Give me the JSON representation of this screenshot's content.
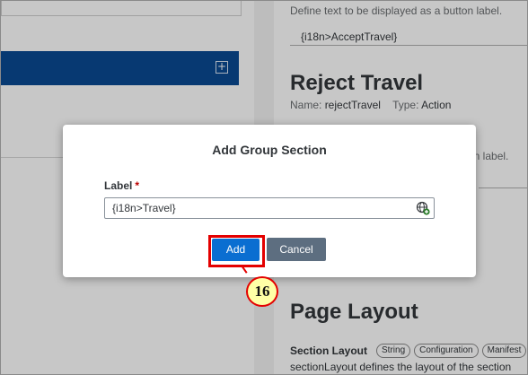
{
  "right_panel": {
    "button_label_description": "Define text to be displayed as a button label.",
    "accept_value": "{i18n>AcceptTravel}",
    "reject_heading": "Reject Travel",
    "name_key": "Name:",
    "name_value": "rejectTravel",
    "type_key": "Type:",
    "type_value": "Action",
    "partial_description": "on label.",
    "page_layout_heading": "Page Layout",
    "section_layout_name": "Section Layout",
    "tags": [
      "String",
      "Configuration",
      "Manifest"
    ],
    "section_layout_description": "sectionLayout defines the layout of the section"
  },
  "dialog": {
    "title": "Add Group Section",
    "label_field": {
      "label": "Label",
      "required_marker": "*",
      "value": "{i18n>Travel}"
    },
    "add_label": "Add",
    "cancel_label": "Cancel"
  },
  "step_badge": "16",
  "colors": {
    "accent_blue": "#0a6ed1",
    "nav_blue": "#0a4a93",
    "highlight_red": "#e40000",
    "badge_fill": "#ffffa6"
  },
  "icons": {
    "plus": "plus-icon",
    "globe": "globe-icon"
  }
}
